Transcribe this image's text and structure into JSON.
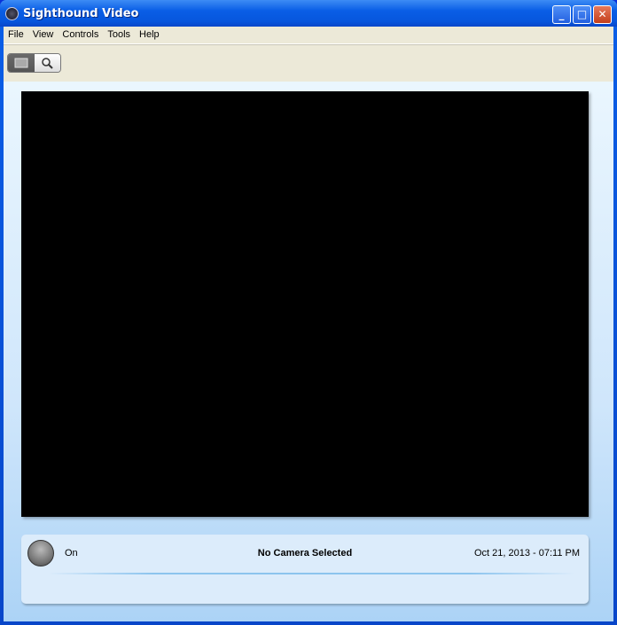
{
  "window": {
    "title": "Sighthound Video",
    "controls": {
      "minimize": "_",
      "maximize": "□",
      "close": "✕"
    }
  },
  "menu": [
    "File",
    "View",
    "Controls",
    "Tools",
    "Help"
  ],
  "toolbar": {
    "buttons": [
      {
        "name": "monitor-view",
        "active": true
      },
      {
        "name": "search-view",
        "active": false
      }
    ]
  },
  "status": {
    "power": "On",
    "camera": "No Camera Selected",
    "datetime": "Oct 21, 2013 - 07:11 PM"
  }
}
